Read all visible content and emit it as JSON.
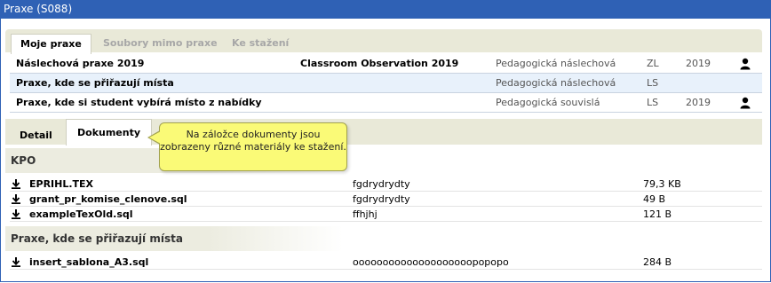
{
  "window": {
    "title": "Praxe (S088)"
  },
  "top_tabs": [
    {
      "label": "Moje praxe",
      "active": true
    },
    {
      "label": "Soubory mimo praxe",
      "active": false
    },
    {
      "label": "Ke stažení",
      "active": false
    }
  ],
  "practices": [
    {
      "name": "Náslechová praxe 2019",
      "title": "Classroom Observation 2019",
      "type": "Pedagogická náslechová",
      "semester": "ZL",
      "year": "2019",
      "person_icon": "person-icon",
      "selected": false
    },
    {
      "name": "Praxe, kde se přiřazují místa",
      "title": "",
      "type": "Pedagogická náslechová",
      "semester": "LS",
      "year": "",
      "person_icon": "",
      "selected": true
    },
    {
      "name": "Praxe, kde si student vybírá místo z nabídky",
      "title": "",
      "type": "Pedagogická souvislá",
      "semester": "LS",
      "year": "2019",
      "person_icon": "person-icon",
      "selected": false
    }
  ],
  "detail_tabs": [
    {
      "label": "Detail",
      "active": false
    },
    {
      "label": "Dokumenty",
      "active": true
    }
  ],
  "tooltip": {
    "text": "Na záložce dokumenty jsou zobrazeny různé materiály ke stažení."
  },
  "groups": [
    {
      "name": "KPO",
      "files": [
        {
          "name": "EPRIHL.TEX",
          "desc": "fgdrydrydty",
          "size": "79,3 KB"
        },
        {
          "name": "grant_pr_komise_clenove.sql",
          "desc": "fgdrydrydty",
          "size": "49 B"
        },
        {
          "name": "exampleTexOld.sql",
          "desc": "ffhjhj",
          "size": "121 B"
        }
      ]
    },
    {
      "name": "Praxe, kde se přiřazují místa",
      "files": [
        {
          "name": "insert_sablona_A3.sql",
          "desc": "oooooooooooooooooooopopopo",
          "size": "284 B"
        }
      ]
    }
  ],
  "colors": {
    "titlebar": "#2f61b5",
    "tab_bar": "#e9e9d8",
    "selected_row": "#e8f1fb",
    "tooltip": "#fafa77"
  }
}
